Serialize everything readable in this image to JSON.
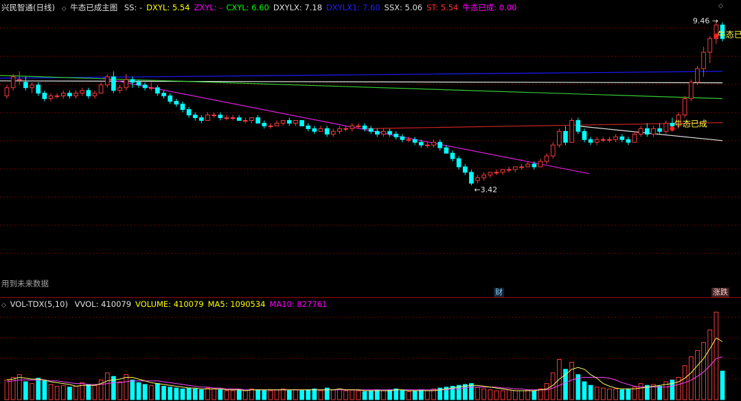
{
  "main_header": {
    "stock_title": "兴民智通(日线)",
    "indicator_name": "牛态已成主图",
    "items": [
      {
        "label": "SS:",
        "value": "-",
        "color": "#e0e0e0"
      },
      {
        "label": "DXYL:",
        "value": "5.54",
        "color": "#ffff00"
      },
      {
        "label": "ZXYL:",
        "value": "-",
        "color": "#ff00ff"
      },
      {
        "label": "CXYL:",
        "value": "6.60",
        "color": "#00ff00"
      },
      {
        "label": "DXYLX:",
        "value": "7.18",
        "color": "#e0e0e0"
      },
      {
        "label": "DXYLX1:",
        "value": "7.60",
        "color": "#2020ff"
      },
      {
        "label": "SSX:",
        "value": "5.06",
        "color": "#e0e0e0"
      },
      {
        "label": "ST:",
        "value": "5.54",
        "color": "#ff3030"
      },
      {
        "label": "牛态已成:",
        "value": "0.00",
        "color": "#ff00ff"
      }
    ]
  },
  "vol_header": {
    "indicator_name": "VOL-TDX(5,10)",
    "items": [
      {
        "label": "VVOL:",
        "value": "410079",
        "color": "#e0e0e0"
      },
      {
        "label": "VOLUME:",
        "value": "410079",
        "color": "#ffff00"
      },
      {
        "label": "MA5:",
        "value": "1090534",
        "color": "#ffff00"
      },
      {
        "label": "MA10:",
        "value": "827761",
        "color": "#ff00ff"
      }
    ]
  },
  "annotations": {
    "high_label": "9.46",
    "low_label": "3.42",
    "bull_signal_text": "牛态已成",
    "bull_signal_text_top": "牛态已",
    "future_data_note": "用到未来数据",
    "finance_badge": "财",
    "limit_badge": "涨跌"
  },
  "colors": {
    "up": "#ff3c3c",
    "down": "#00ffff",
    "grid": "#7a0000",
    "panel_border": "#a00000",
    "line_blue": "#1a1aff",
    "line_green": "#33cc33",
    "line_white": "#e8e8e8",
    "line_red": "#cc2222",
    "line_magenta": "#e020e0",
    "ma5": "#ffff66",
    "ma10": "#ff44ff"
  },
  "chart_data": {
    "type": "candlestick",
    "price_range": [
      3.42,
      9.46
    ],
    "candles": [
      [
        6.7,
        7.1,
        6.6,
        7.0
      ],
      [
        7.0,
        7.5,
        6.9,
        7.4
      ],
      [
        7.3,
        7.6,
        7.1,
        7.3
      ],
      [
        7.2,
        7.4,
        6.9,
        7.0
      ],
      [
        7.0,
        7.2,
        6.8,
        7.1
      ],
      [
        7.1,
        7.2,
        6.7,
        6.8
      ],
      [
        6.8,
        6.9,
        6.5,
        6.6
      ],
      [
        6.6,
        6.8,
        6.5,
        6.7
      ],
      [
        6.7,
        6.8,
        6.6,
        6.7
      ],
      [
        6.7,
        6.9,
        6.6,
        6.8
      ],
      [
        6.8,
        6.9,
        6.6,
        6.7
      ],
      [
        6.7,
        6.9,
        6.6,
        6.8
      ],
      [
        6.8,
        7.0,
        6.7,
        6.9
      ],
      [
        6.9,
        7.0,
        6.6,
        6.7
      ],
      [
        6.7,
        6.9,
        6.6,
        6.8
      ],
      [
        6.8,
        7.2,
        6.8,
        7.1
      ],
      [
        7.1,
        7.5,
        7.0,
        7.4
      ],
      [
        7.4,
        7.6,
        6.8,
        6.9
      ],
      [
        6.9,
        7.1,
        6.8,
        7.0
      ],
      [
        7.0,
        7.5,
        6.9,
        7.3
      ],
      [
        7.3,
        7.4,
        7.0,
        7.2
      ],
      [
        7.2,
        7.3,
        7.0,
        7.1
      ],
      [
        7.1,
        7.2,
        6.9,
        7.0
      ],
      [
        7.0,
        7.2,
        6.9,
        7.0
      ],
      [
        7.0,
        7.1,
        6.7,
        6.8
      ],
      [
        6.8,
        6.9,
        6.6,
        6.7
      ],
      [
        6.7,
        6.8,
        6.4,
        6.5
      ],
      [
        6.5,
        6.6,
        6.3,
        6.4
      ],
      [
        6.4,
        6.5,
        6.1,
        6.2
      ],
      [
        6.2,
        6.3,
        5.9,
        6.0
      ],
      [
        6.0,
        6.1,
        5.8,
        5.9
      ],
      [
        5.9,
        6.0,
        5.7,
        5.8
      ],
      [
        5.8,
        6.1,
        5.8,
        6.0
      ],
      [
        6.0,
        6.1,
        5.9,
        6.0
      ],
      [
        6.0,
        6.1,
        5.8,
        5.9
      ],
      [
        5.9,
        6.0,
        5.8,
        5.9
      ],
      [
        5.9,
        6.0,
        5.8,
        5.9
      ],
      [
        5.9,
        6.0,
        5.8,
        5.8
      ],
      [
        5.8,
        5.9,
        5.7,
        5.8
      ],
      [
        5.8,
        5.9,
        5.7,
        5.9
      ],
      [
        5.9,
        6.0,
        5.7,
        5.7
      ],
      [
        5.7,
        5.8,
        5.5,
        5.6
      ],
      [
        5.6,
        5.7,
        5.5,
        5.6
      ],
      [
        5.6,
        5.8,
        5.6,
        5.7
      ],
      [
        5.7,
        5.8,
        5.6,
        5.8
      ],
      [
        5.8,
        5.9,
        5.6,
        5.7
      ],
      [
        5.7,
        5.8,
        5.6,
        5.8
      ],
      [
        5.8,
        5.8,
        5.6,
        5.6
      ],
      [
        5.6,
        5.7,
        5.4,
        5.5
      ],
      [
        5.5,
        5.6,
        5.3,
        5.4
      ],
      [
        5.4,
        5.6,
        5.4,
        5.5
      ],
      [
        5.5,
        5.6,
        5.2,
        5.3
      ],
      [
        5.3,
        5.5,
        5.2,
        5.4
      ],
      [
        5.4,
        5.6,
        5.3,
        5.5
      ],
      [
        5.5,
        5.6,
        5.4,
        5.5
      ],
      [
        5.5,
        5.7,
        5.4,
        5.6
      ],
      [
        5.6,
        5.7,
        5.5,
        5.6
      ],
      [
        5.6,
        5.7,
        5.4,
        5.5
      ],
      [
        5.5,
        5.6,
        5.3,
        5.4
      ],
      [
        5.4,
        5.5,
        5.2,
        5.3
      ],
      [
        5.3,
        5.5,
        5.2,
        5.4
      ],
      [
        5.4,
        5.5,
        5.2,
        5.3
      ],
      [
        5.3,
        5.4,
        5.1,
        5.2
      ],
      [
        5.2,
        5.3,
        5.0,
        5.1
      ],
      [
        5.1,
        5.2,
        5.0,
        5.1
      ],
      [
        5.1,
        5.2,
        4.9,
        5.0
      ],
      [
        5.0,
        5.1,
        4.8,
        4.9
      ],
      [
        4.9,
        5.0,
        4.8,
        4.9
      ],
      [
        4.9,
        5.1,
        4.8,
        5.0
      ],
      [
        5.0,
        5.1,
        4.7,
        4.8
      ],
      [
        4.8,
        4.9,
        4.6,
        4.6
      ],
      [
        4.6,
        4.7,
        4.3,
        4.4
      ],
      [
        4.4,
        4.5,
        4.0,
        4.1
      ],
      [
        4.1,
        4.2,
        3.8,
        3.9
      ],
      [
        3.9,
        4.0,
        3.42,
        3.5
      ],
      [
        3.6,
        3.8,
        3.5,
        3.7
      ],
      [
        3.7,
        3.9,
        3.6,
        3.8
      ],
      [
        3.8,
        3.9,
        3.7,
        3.9
      ],
      [
        3.9,
        4.0,
        3.8,
        3.9
      ],
      [
        3.9,
        4.0,
        3.8,
        4.0
      ],
      [
        4.0,
        4.1,
        3.9,
        4.0
      ],
      [
        4.0,
        4.1,
        3.9,
        4.1
      ],
      [
        4.1,
        4.2,
        4.0,
        4.1
      ],
      [
        4.1,
        4.3,
        4.1,
        4.2
      ],
      [
        4.2,
        4.3,
        4.0,
        4.1
      ],
      [
        4.1,
        4.4,
        4.1,
        4.3
      ],
      [
        4.3,
        4.6,
        4.2,
        4.5
      ],
      [
        4.5,
        5.0,
        4.4,
        4.9
      ],
      [
        4.9,
        5.5,
        4.8,
        5.4
      ],
      [
        5.4,
        5.6,
        4.9,
        5.0
      ],
      [
        5.0,
        5.9,
        5.0,
        5.8
      ],
      [
        5.8,
        5.9,
        5.3,
        5.4
      ],
      [
        5.4,
        5.5,
        5.0,
        5.1
      ],
      [
        5.1,
        5.2,
        4.9,
        5.0
      ],
      [
        5.0,
        5.2,
        4.9,
        5.1
      ],
      [
        5.1,
        5.2,
        5.0,
        5.1
      ],
      [
        5.1,
        5.2,
        5.0,
        5.1
      ],
      [
        5.1,
        5.3,
        5.0,
        5.2
      ],
      [
        5.2,
        5.3,
        5.0,
        5.1
      ],
      [
        5.1,
        5.2,
        4.9,
        5.0
      ],
      [
        5.0,
        5.4,
        5.0,
        5.3
      ],
      [
        5.3,
        5.6,
        5.2,
        5.5
      ],
      [
        5.5,
        5.7,
        5.2,
        5.3
      ],
      [
        5.3,
        5.6,
        5.2,
        5.5
      ],
      [
        5.5,
        5.7,
        5.3,
        5.4
      ],
      [
        5.4,
        5.8,
        5.3,
        5.7
      ],
      [
        5.7,
        5.9,
        5.4,
        5.6
      ],
      [
        5.6,
        6.1,
        5.5,
        6.0
      ],
      [
        6.0,
        6.7,
        5.9,
        6.6
      ],
      [
        6.6,
        7.3,
        6.5,
        7.2
      ],
      [
        7.2,
        7.8,
        7.1,
        7.7
      ],
      [
        7.7,
        8.5,
        7.4,
        8.3
      ],
      [
        8.3,
        8.9,
        7.9,
        8.8
      ],
      [
        8.8,
        9.46,
        8.6,
        9.3
      ],
      [
        9.3,
        9.4,
        8.7,
        8.8
      ]
    ],
    "volume": [
      0.22,
      0.25,
      0.28,
      0.2,
      0.18,
      0.24,
      0.21,
      0.17,
      0.15,
      0.16,
      0.14,
      0.15,
      0.19,
      0.17,
      0.16,
      0.22,
      0.3,
      0.26,
      0.2,
      0.28,
      0.22,
      0.19,
      0.17,
      0.16,
      0.18,
      0.15,
      0.14,
      0.13,
      0.12,
      0.13,
      0.12,
      0.11,
      0.13,
      0.12,
      0.11,
      0.1,
      0.1,
      0.11,
      0.1,
      0.12,
      0.11,
      0.1,
      0.1,
      0.11,
      0.12,
      0.1,
      0.11,
      0.1,
      0.11,
      0.12,
      0.1,
      0.13,
      0.11,
      0.12,
      0.1,
      0.11,
      0.1,
      0.09,
      0.1,
      0.11,
      0.1,
      0.11,
      0.12,
      0.1,
      0.09,
      0.1,
      0.11,
      0.1,
      0.12,
      0.13,
      0.14,
      0.15,
      0.16,
      0.17,
      0.18,
      0.14,
      0.12,
      0.11,
      0.1,
      0.1,
      0.11,
      0.1,
      0.1,
      0.11,
      0.1,
      0.12,
      0.18,
      0.3,
      0.45,
      0.34,
      0.42,
      0.28,
      0.2,
      0.16,
      0.14,
      0.13,
      0.12,
      0.12,
      0.11,
      0.12,
      0.14,
      0.18,
      0.16,
      0.17,
      0.15,
      0.2,
      0.22,
      0.25,
      0.38,
      0.48,
      0.55,
      0.64,
      0.78,
      0.98,
      0.32
    ],
    "ma5": [
      0.22,
      0.23,
      0.25,
      0.24,
      0.23,
      0.23,
      0.22,
      0.2,
      0.19,
      0.18,
      0.17,
      0.15,
      0.16,
      0.16,
      0.16,
      0.18,
      0.21,
      0.22,
      0.23,
      0.25,
      0.25,
      0.23,
      0.21,
      0.19,
      0.18,
      0.17,
      0.16,
      0.15,
      0.14,
      0.13,
      0.13,
      0.12,
      0.12,
      0.12,
      0.12,
      0.11,
      0.11,
      0.11,
      0.1,
      0.11,
      0.11,
      0.11,
      0.11,
      0.11,
      0.11,
      0.11,
      0.11,
      0.11,
      0.11,
      0.11,
      0.11,
      0.11,
      0.11,
      0.12,
      0.11,
      0.11,
      0.11,
      0.1,
      0.1,
      0.1,
      0.1,
      0.1,
      0.11,
      0.11,
      0.1,
      0.1,
      0.1,
      0.1,
      0.1,
      0.11,
      0.12,
      0.13,
      0.14,
      0.15,
      0.16,
      0.16,
      0.15,
      0.14,
      0.13,
      0.12,
      0.11,
      0.1,
      0.1,
      0.1,
      0.1,
      0.11,
      0.12,
      0.16,
      0.23,
      0.28,
      0.34,
      0.36,
      0.34,
      0.28,
      0.24,
      0.18,
      0.15,
      0.13,
      0.12,
      0.12,
      0.12,
      0.13,
      0.14,
      0.15,
      0.16,
      0.17,
      0.18,
      0.2,
      0.24,
      0.3,
      0.38,
      0.46,
      0.57,
      0.69,
      0.65
    ],
    "ma10": [
      0.2,
      0.21,
      0.22,
      0.22,
      0.22,
      0.22,
      0.22,
      0.21,
      0.21,
      0.2,
      0.19,
      0.18,
      0.18,
      0.17,
      0.17,
      0.17,
      0.18,
      0.19,
      0.19,
      0.2,
      0.21,
      0.21,
      0.21,
      0.21,
      0.21,
      0.2,
      0.19,
      0.18,
      0.17,
      0.16,
      0.15,
      0.14,
      0.14,
      0.13,
      0.13,
      0.12,
      0.12,
      0.12,
      0.11,
      0.11,
      0.11,
      0.11,
      0.11,
      0.11,
      0.11,
      0.11,
      0.11,
      0.11,
      0.11,
      0.11,
      0.11,
      0.11,
      0.11,
      0.11,
      0.11,
      0.11,
      0.11,
      0.11,
      0.11,
      0.11,
      0.11,
      0.11,
      0.11,
      0.11,
      0.11,
      0.11,
      0.11,
      0.11,
      0.11,
      0.11,
      0.11,
      0.12,
      0.12,
      0.13,
      0.14,
      0.14,
      0.14,
      0.14,
      0.14,
      0.13,
      0.13,
      0.12,
      0.12,
      0.11,
      0.11,
      0.11,
      0.11,
      0.13,
      0.16,
      0.19,
      0.22,
      0.24,
      0.25,
      0.25,
      0.25,
      0.25,
      0.24,
      0.22,
      0.19,
      0.17,
      0.15,
      0.14,
      0.14,
      0.14,
      0.14,
      0.14,
      0.15,
      0.17,
      0.19,
      0.22,
      0.26,
      0.31,
      0.38,
      0.46,
      0.48
    ]
  }
}
